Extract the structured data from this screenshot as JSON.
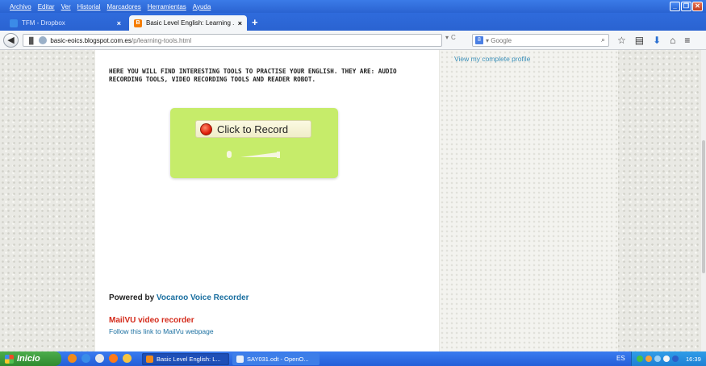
{
  "browser": {
    "menu": [
      "Archivo",
      "Editar",
      "Ver",
      "Historial",
      "Marcadores",
      "Herramientas",
      "Ayuda"
    ],
    "tabs": [
      {
        "title": "TFM - Dropbox",
        "active": false
      },
      {
        "title": "Basic Level English: Learning ...",
        "active": true
      }
    ],
    "url_host": "basic-eoics.blogspot.com.es",
    "url_path": "/p/learning-tools.html",
    "search_engine": "Google",
    "search_placeholder": "Google"
  },
  "page": {
    "intro_text": "HERE YOU WILL FIND INTERESTING TOOLS TO PRACTISE YOUR ENGLISH. THEY ARE: AUDIO RECORDING TOOLS, VIDEO RECORDING TOOLS AND READER ROBOT.",
    "record_button_label": "Click to Record",
    "powered_prefix": "Powered by ",
    "powered_link": "Vocaroo Voice Recorder",
    "mailvu_title": "MailVU video recorder",
    "mailvu_link": "Follow this link to MailVu webpage",
    "profile_link": "View my complete profile"
  },
  "taskbar": {
    "start_label": "Inicio",
    "tasks": [
      {
        "label": "Basic Level English: L..."
      },
      {
        "label": "SAY031.odt - OpenO..."
      }
    ],
    "language": "ES",
    "clock": "16:39"
  },
  "colors": {
    "widget_bg": "#c6ec6a",
    "link": "#1a6fa0",
    "mailvu_red": "#d42a1a",
    "xp_blue": "#245ed8"
  }
}
